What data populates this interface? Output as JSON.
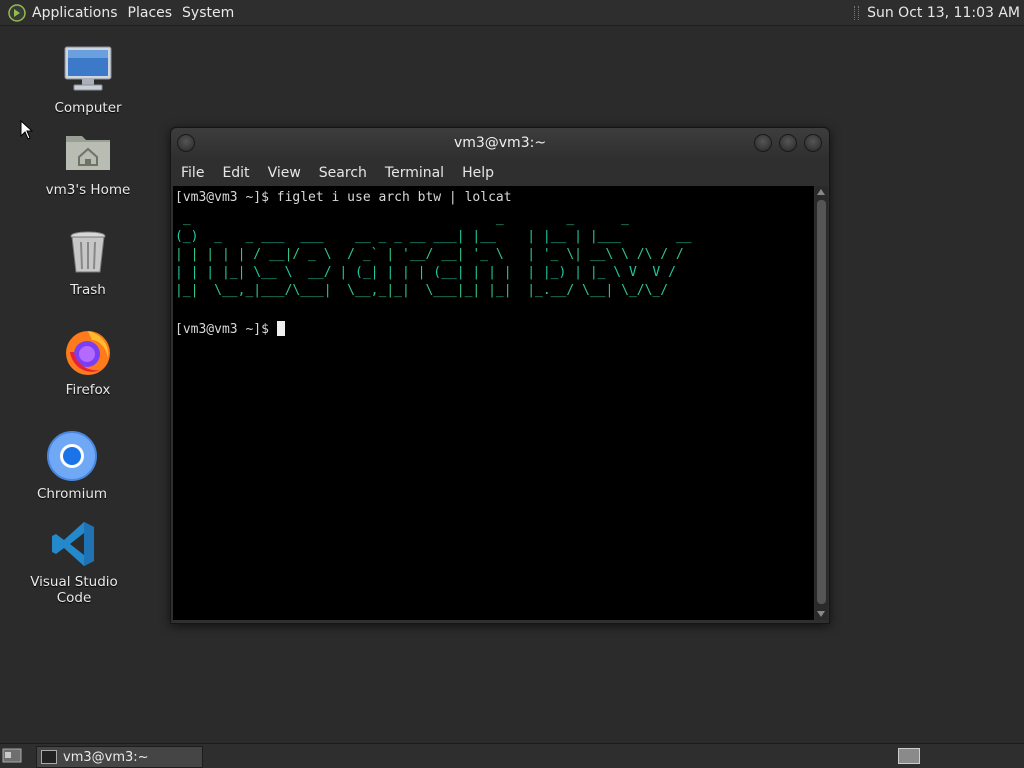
{
  "top_panel": {
    "menus": [
      "Applications",
      "Places",
      "System"
    ],
    "clock": "Sun Oct 13, 11:03 AM"
  },
  "desktop_icons": [
    {
      "label": "Computer",
      "icon": "computer-icon"
    },
    {
      "label": "vm3's Home",
      "icon": "home-folder-icon"
    },
    {
      "label": "Trash",
      "icon": "trash-icon"
    },
    {
      "label": "Firefox",
      "icon": "firefox-icon"
    },
    {
      "label": "Chromium",
      "icon": "chromium-icon"
    },
    {
      "label": "Visual Studio Code",
      "icon": "vscode-icon"
    }
  ],
  "terminal": {
    "title": "vm3@vm3:~",
    "menu": [
      "File",
      "Edit",
      "View",
      "Search",
      "Terminal",
      "Help"
    ],
    "command_line": "[vm3@vm3 ~]$ figlet i use arch btw | lolcat",
    "figlet_lines": [
      " _                                       _        _      _",
      "(_)  _   _ ___  ___    __ _ _ __ ___| |__    | |__ | |___       __",
      "| | | | | / __|/ _ \\  / _` | '__/ __| '_ \\   | '_ \\| __\\ \\ /\\ / /",
      "| | | |_| \\__ \\  __/ | (_| | | | (__| | | |  | |_) | |_ \\ V  V /",
      "|_|  \\__,_|___/\\___|  \\__,_|_|  \\___|_| |_|  |_.__/ \\__| \\_/\\_/"
    ],
    "prompt": "[vm3@vm3 ~]$ "
  },
  "bottom_panel": {
    "task_label": "vm3@vm3:~"
  },
  "colors": {
    "desktop_bg": "#2b2b2b",
    "panel_bg": "#2e2e2e",
    "figlet_text": "#1ec9a0"
  }
}
